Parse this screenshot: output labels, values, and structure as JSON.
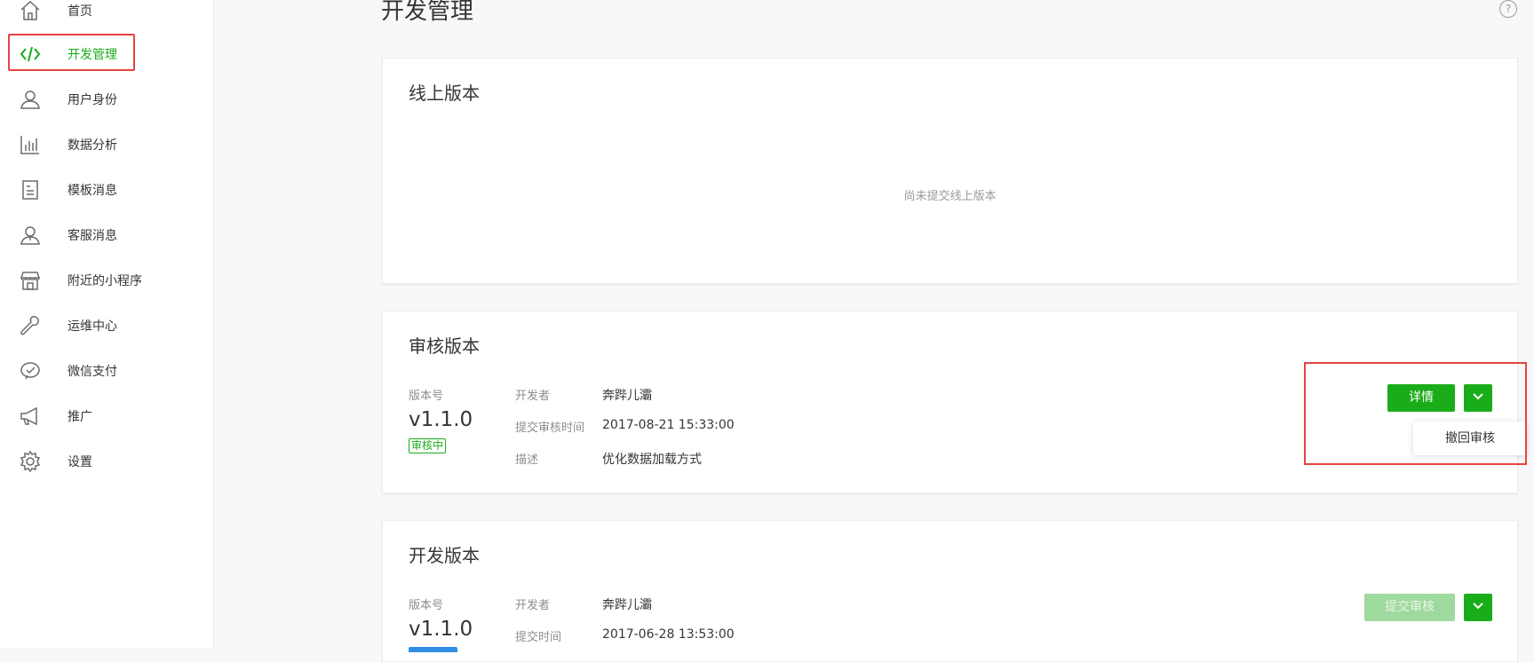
{
  "sidebar": {
    "items": [
      {
        "label": "首页",
        "icon": "home-icon"
      },
      {
        "label": "开发管理",
        "icon": "code-icon",
        "active": true
      },
      {
        "label": "用户身份",
        "icon": "user-icon"
      },
      {
        "label": "数据分析",
        "icon": "bar-chart-icon"
      },
      {
        "label": "模板消息",
        "icon": "document-icon"
      },
      {
        "label": "客服消息",
        "icon": "customer-service-icon"
      },
      {
        "label": "附近的小程序",
        "icon": "store-icon"
      },
      {
        "label": "运维中心",
        "icon": "wrench-icon"
      },
      {
        "label": "微信支付",
        "icon": "wechat-pay-icon"
      },
      {
        "label": "推广",
        "icon": "megaphone-icon"
      },
      {
        "label": "设置",
        "icon": "gear-icon"
      }
    ]
  },
  "page": {
    "title": "开发管理",
    "help": "?"
  },
  "online": {
    "title": "线上版本",
    "empty_text": "尚未提交线上版本"
  },
  "review": {
    "title": "审核版本",
    "version_label": "版本号",
    "version": "v1.1.0",
    "status": "审核中",
    "developer_label": "开发者",
    "developer": "奔跸儿灞",
    "time_label": "提交审核时间",
    "time": "2017-08-21 15:33:00",
    "desc_label": "描述",
    "desc": "优化数据加载方式",
    "detail_button": "详情",
    "dropdown_item": "撤回审核"
  },
  "dev": {
    "title": "开发版本",
    "version_label": "版本号",
    "version": "v1.1.0",
    "developer_label": "开发者",
    "developer": "奔跸儿灞",
    "time_label": "提交时间",
    "time": "2017-06-28 13:53:00",
    "submit_button": "提交审核"
  },
  "colors": {
    "accent": "#1aad19",
    "highlight": "#e64340",
    "background": "#f6f8f9"
  }
}
